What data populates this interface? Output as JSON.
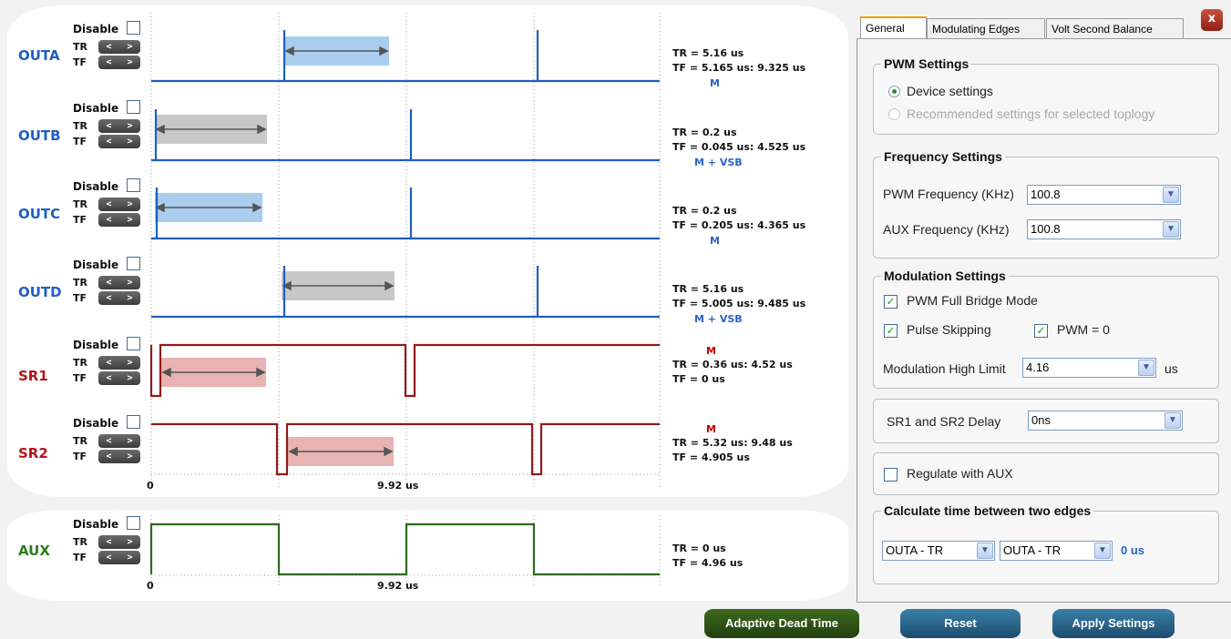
{
  "channels": [
    {
      "name": "OUTA",
      "color": "#1f5fbf",
      "disable_label": "Disable",
      "tr_label": "TR",
      "tf_label": "TF",
      "line1": "TR = 5.16 us",
      "line2": "TF = 5.165 us: 9.325 us",
      "tag": "M"
    },
    {
      "name": "OUTB",
      "color": "#1f5fbf",
      "disable_label": "Disable",
      "tr_label": "TR",
      "tf_label": "TF",
      "line1": "TR = 0.2 us",
      "line2": "TF = 0.045 us: 4.525 us",
      "tag": "M + VSB"
    },
    {
      "name": "OUTC",
      "color": "#1f5fbf",
      "disable_label": "Disable",
      "tr_label": "TR",
      "tf_label": "TF",
      "line1": "TR = 0.2 us",
      "line2": "TF = 0.205 us: 4.365 us",
      "tag": "M"
    },
    {
      "name": "OUTD",
      "color": "#1f5fbf",
      "disable_label": "Disable",
      "tr_label": "TR",
      "tf_label": "TF",
      "line1": "TR = 5.16 us",
      "line2": "TF = 5.005 us: 9.485 us",
      "tag": "M + VSB"
    },
    {
      "name": "SR1",
      "color": "#b3151b",
      "disable_label": "Disable",
      "tr_label": "TR",
      "tf_label": "TF",
      "tag": "M",
      "line1": "TR = 0.36 us: 4.52 us",
      "line2": "TF = 0 us"
    },
    {
      "name": "SR2",
      "color": "#b3151b",
      "disable_label": "Disable",
      "tr_label": "TR",
      "tf_label": "TF",
      "tag": "M",
      "line1": "TR = 5.32 us: 9.48 us",
      "line2": "TF = 4.905 us"
    },
    {
      "name": "AUX",
      "color": "#2e7d1e",
      "disable_label": "Disable",
      "tr_label": "TR",
      "tf_label": "TF",
      "line1": "TR = 0 us",
      "line2": "TF = 4.96 us"
    }
  ],
  "axis": {
    "zero": "0",
    "mid": "9.92 us",
    "aux_zero": "0",
    "aux_mid": "9.92 us"
  },
  "arrows": {
    "left": "<",
    "right": ">"
  },
  "tabs": [
    "General",
    "Modulating Edges",
    "Volt Second Balance"
  ],
  "close_label": "x",
  "pwm_settings": {
    "title": "PWM Settings",
    "opt1": "Device settings",
    "opt2": "Recommended settings for selected toplogy"
  },
  "frequency": {
    "title": "Frequency Settings",
    "pwm_label": "PWM Frequency (KHz)",
    "pwm_value": "100.8",
    "aux_label": "AUX Frequency (KHz)",
    "aux_value": "100.8"
  },
  "modulation": {
    "title": "Modulation Settings",
    "full_bridge": "PWM Full Bridge Mode",
    "pulse_skip": "Pulse Skipping",
    "pwm0": "PWM = 0",
    "high_limit_label": "Modulation High Limit",
    "high_limit_value": "4.16",
    "unit": "us"
  },
  "sr_delay": {
    "label": "SR1 and SR2 Delay",
    "value": "0ns"
  },
  "regulate": {
    "label": "Regulate with AUX"
  },
  "calc": {
    "title": "Calculate time between two edges",
    "edge1": "OUTA - TR",
    "edge2": "OUTA - TR",
    "result": "0 us"
  },
  "buttons": {
    "adaptive": "Adaptive Dead Time",
    "reset": "Reset",
    "apply": "Apply Settings"
  }
}
